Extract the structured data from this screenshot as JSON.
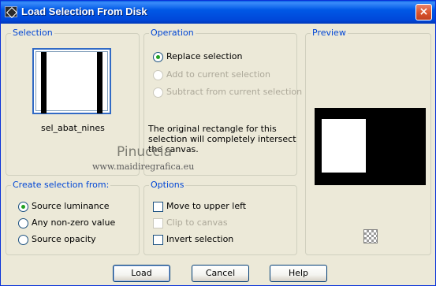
{
  "window": {
    "title": "Load Selection From Disk",
    "close_label": "×"
  },
  "selection": {
    "legend": "Selection",
    "name": "sel_abat_nines"
  },
  "operation": {
    "legend": "Operation",
    "options": [
      {
        "label": "Replace selection",
        "checked": true,
        "enabled": true
      },
      {
        "label": "Add to current selection",
        "checked": false,
        "enabled": false
      },
      {
        "label": "Subtract from current selection",
        "checked": false,
        "enabled": false
      }
    ],
    "info": "The original rectangle for this selection will completely intersect the canvas."
  },
  "preview": {
    "legend": "Preview"
  },
  "create_from": {
    "legend": "Create selection from:",
    "options": [
      {
        "label": "Source luminance",
        "checked": true
      },
      {
        "label": "Any non-zero value",
        "checked": false
      },
      {
        "label": "Source opacity",
        "checked": false
      }
    ]
  },
  "options_group": {
    "legend": "Options",
    "items": [
      {
        "label": "Move to upper left",
        "checked": false,
        "enabled": true
      },
      {
        "label": "Clip to canvas",
        "checked": false,
        "enabled": false
      },
      {
        "label": "Invert selection",
        "checked": false,
        "enabled": true
      }
    ]
  },
  "watermark": {
    "name": "Pinuccia",
    "url": "www.maidiregrafica.eu"
  },
  "buttons": {
    "load": "Load",
    "cancel": "Cancel",
    "help": "Help"
  },
  "colors": {
    "title_bar": "#0058e6",
    "legend_text": "#0046d5",
    "radio_dot": "#21a121",
    "dialog_bg": "#ece9d8"
  }
}
